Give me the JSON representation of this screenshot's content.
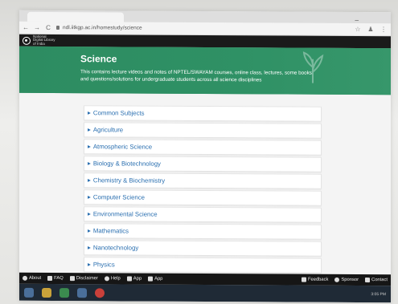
{
  "browser": {
    "url": "ndl.iitkgp.ac.in/homestudy/science",
    "nav_back": "←",
    "nav_forward": "→",
    "nav_reload": "C",
    "star_icon": "☆",
    "profile_icon": "♟",
    "menu_icon": "⋮",
    "minimize": "_"
  },
  "logo": {
    "line1": "National",
    "line2": "Digital Library",
    "line3": "of India"
  },
  "banner": {
    "title": "Science",
    "description": "This contains lecture videos and notes of NPTEL/SWAYAM courses, online class, lectures, some books and questions/solutions for undergraduate students across all science disciplines",
    "color": "#2c8c61"
  },
  "subjects": [
    "Common Subjects",
    "Agriculture",
    "Atmospheric Science",
    "Biology & Biotechnology",
    "Chemistry & Biochemistry",
    "Computer Science",
    "Environmental Science",
    "Mathematics",
    "Nanotechnology",
    "Physics"
  ],
  "footer": {
    "about": "About",
    "faq": "FAQ",
    "disclaimer": "Disclaimer",
    "help": "Help",
    "app1": "App",
    "app2": "App",
    "feedback": "Feedback",
    "sponsor": "Sponsor",
    "contact": "Contact"
  },
  "taskbar": {
    "clock": "3:05 PM"
  }
}
